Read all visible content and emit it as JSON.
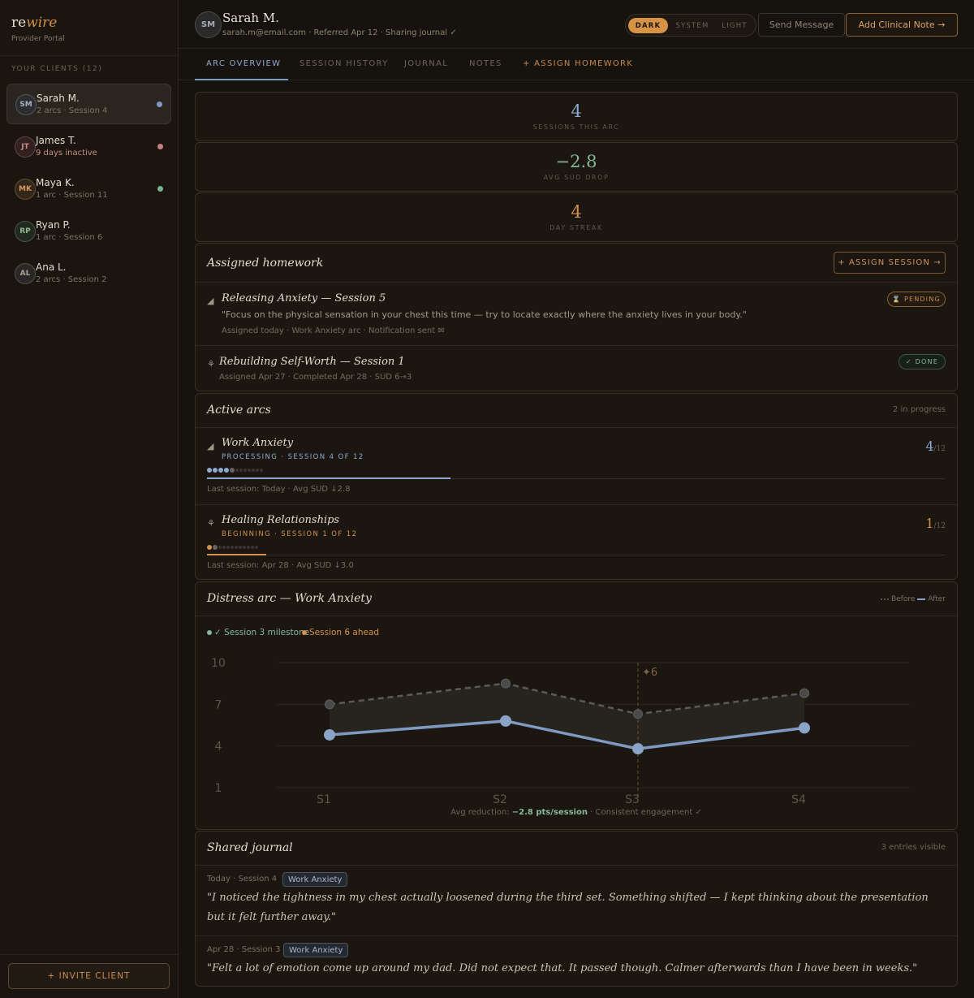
{
  "sidebar": {
    "logo_a": "re",
    "logo_b": "wire",
    "logo_sub": "Provider Portal",
    "clients_header": "YOUR CLIENTS (12)",
    "clients": [
      {
        "initials": "SM",
        "name": "Sarah M.",
        "sub": "2 arcs · Session 4",
        "dot": "#7f9ac2",
        "avatar_bg": "#2b2d30",
        "avatar_fg": "#a6b0be",
        "sub_color": "#7d7366"
      },
      {
        "initials": "JT",
        "name": "James T.",
        "sub": "9 days inactive",
        "dot": "#c9807f",
        "avatar_bg": "#322120",
        "avatar_fg": "#c88a86",
        "sub_color": "#c98a84"
      },
      {
        "initials": "MK",
        "name": "Maya K.",
        "sub": "1 arc · Session 11",
        "dot": "#79b08f",
        "avatar_bg": "#33261a",
        "avatar_fg": "#d39a5a",
        "sub_color": "#7d7366"
      },
      {
        "initials": "RP",
        "name": "Ryan P.",
        "sub": "1 arc · Session 6",
        "dot": "",
        "avatar_bg": "#22291f",
        "avatar_fg": "#8fb593",
        "sub_color": "#7d7366"
      },
      {
        "initials": "AL",
        "name": "Ana L.",
        "sub": "2 arcs · Session 2",
        "dot": "",
        "avatar_bg": "#292826",
        "avatar_fg": "#a7a29a",
        "sub_color": "#7d7366"
      }
    ],
    "invite_label": "+ INVITE CLIENT"
  },
  "header": {
    "initials": "SM",
    "name": "Sarah M.",
    "sub": "sarah.m@email.com · Referred Apr 12 · Sharing journal ✓",
    "theme": {
      "dark": "DARK",
      "system": "SYSTEM",
      "light": "LIGHT",
      "selected": "DARK"
    },
    "send_message": "Send Message",
    "add_note": "Add Clinical Note →"
  },
  "tabs": [
    "ARC OVERVIEW",
    "SESSION HISTORY",
    "JOURNAL",
    "NOTES",
    "+ ASSIGN HOMEWORK"
  ],
  "stats": [
    {
      "value": "4",
      "label": "SESSIONS THIS ARC",
      "color": "#8eaad2"
    },
    {
      "value": "−2.8",
      "label": "AVG SUD DROP",
      "color": "#86b79b"
    },
    {
      "value": "4",
      "label": "DAY STREAK",
      "color": "#d4914d"
    }
  ],
  "homework": {
    "title": "Assigned homework",
    "assign_label": "+ ASSIGN SESSION →",
    "items": [
      {
        "icon": "◢",
        "title": "Releasing Anxiety — Session 5",
        "quote": "\"Focus on the physical sensation in your chest this time — try to locate exactly where the anxiety lives in your body.\"",
        "meta": "Assigned today · Work Anxiety arc · Notification sent ✉",
        "status": "⌛ PENDING"
      },
      {
        "icon": "⚘",
        "title": "Rebuilding Self-Worth — Session 1",
        "meta": "Assigned Apr 27 · Completed Apr 28 · SUD 6→3",
        "status": "✓ DONE"
      }
    ]
  },
  "arcs": {
    "title": "Active arcs",
    "meta": "2 in progress",
    "items": [
      {
        "icon": "◢",
        "name": "Work Anxiety",
        "stage": "PROCESSING · SESSION 4 OF 12",
        "count": "4",
        "total": "/12",
        "color": "#8eaad2",
        "progress": 0.33,
        "done": 4,
        "last": "Last session: Today · Avg SUD ↓2.8"
      },
      {
        "icon": "⚘",
        "name": "Healing Relationships",
        "stage": "BEGINNING · SESSION 1 OF 12",
        "count": "1",
        "total": "/12",
        "color": "#d4914d",
        "progress": 0.08,
        "done": 1,
        "last": "Last session: Apr 28 · Avg SUD ↓3.0"
      }
    ]
  },
  "distress": {
    "title": "Distress arc — Work Anxiety",
    "legend_before": "Before",
    "legend_after": "After",
    "milestone_1": "✓ Session 3 milestone",
    "milestone_2": "Session 6 ahead",
    "marker_label": "✦6",
    "footer_prefix": "Avg reduction: ",
    "footer_value": "−2.8 pts/session",
    "footer_suffix": " · Consistent engagement ✓"
  },
  "chart_data": {
    "type": "line",
    "categories": [
      "S1",
      "S2",
      "S3",
      "S4"
    ],
    "series": [
      {
        "name": "Before",
        "values": [
          7.0,
          8.5,
          6.3,
          7.8
        ]
      },
      {
        "name": "After",
        "values": [
          4.8,
          5.8,
          3.8,
          5.3
        ]
      }
    ],
    "ylim": [
      1,
      10
    ],
    "yticks": [
      10,
      7,
      4,
      1
    ],
    "grid": true,
    "legend": "top-right"
  },
  "journal": {
    "title": "Shared journal",
    "meta": "3 entries visible",
    "entries": [
      {
        "meta": "Today · Session 4",
        "tag": "Work Anxiety",
        "text": "\"I noticed the tightness in my chest actually loosened during the third set. Something shifted — I kept thinking about the presentation but it felt further away.\""
      },
      {
        "meta": "Apr 28 · Session 3",
        "tag": "Work Anxiety",
        "text": "\"Felt a lot of emotion come up around my dad. Did not expect that. It passed though. Calmer afterwards than I have been in weeks.\""
      }
    ]
  }
}
